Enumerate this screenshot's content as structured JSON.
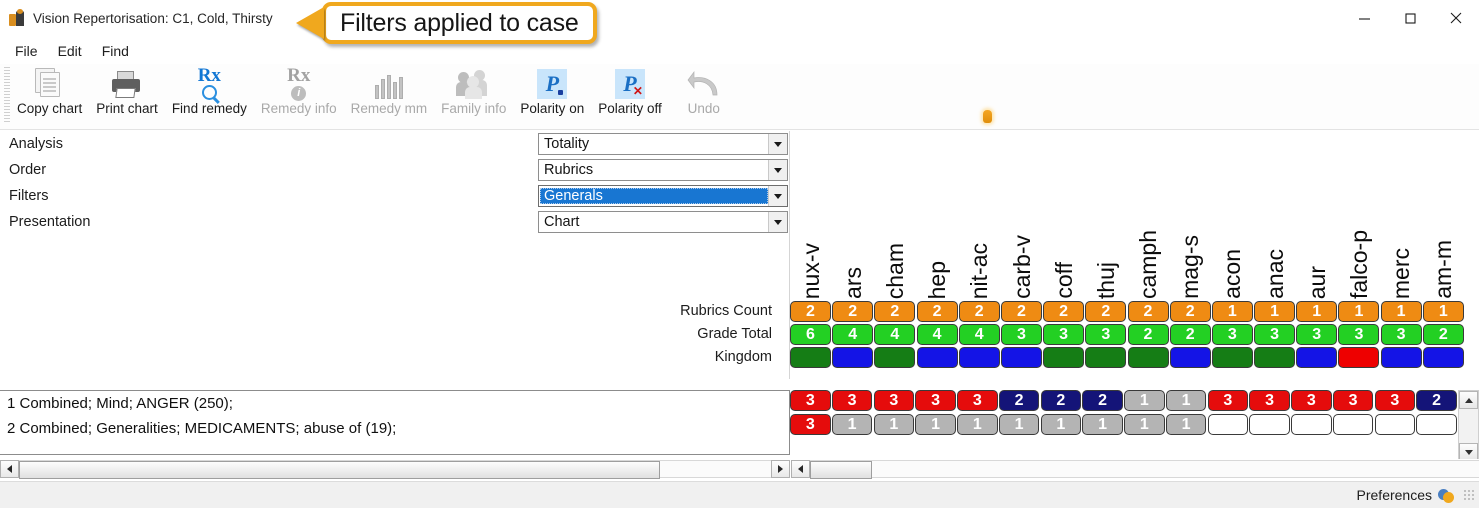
{
  "window": {
    "title": "Vision Repertorisation: C1, Cold, Thirsty",
    "app_icon": "vision-app-icon",
    "minimize": "–",
    "maximize": "□",
    "close": "✕"
  },
  "callout": {
    "text": "Filters applied to case",
    "accent_color": "#f0a81e"
  },
  "menubar": {
    "items": [
      {
        "label": "File"
      },
      {
        "label": "Edit"
      },
      {
        "label": "Find"
      }
    ]
  },
  "toolbar": {
    "buttons": [
      {
        "label": "Copy chart",
        "icon": "copy-chart-icon",
        "enabled": true
      },
      {
        "label": "Print chart",
        "icon": "print-chart-icon",
        "enabled": true
      },
      {
        "label": "Find remedy",
        "icon": "find-remedy-icon",
        "enabled": true
      },
      {
        "label": "Remedy info",
        "icon": "remedy-info-icon",
        "enabled": false
      },
      {
        "label": "Remedy mm",
        "icon": "remedy-mm-icon",
        "enabled": false
      },
      {
        "label": "Family info",
        "icon": "family-info-icon",
        "enabled": false
      },
      {
        "label": "Polarity on",
        "icon": "polarity-on-icon",
        "enabled": true
      },
      {
        "label": "Polarity off",
        "icon": "polarity-off-icon",
        "enabled": true
      },
      {
        "label": "Undo",
        "icon": "undo-icon",
        "enabled": false
      }
    ]
  },
  "settings": {
    "rows": [
      {
        "label": "Analysis",
        "value": "Totality",
        "selected": false
      },
      {
        "label": "Order",
        "value": "Rubrics",
        "selected": false
      },
      {
        "label": "Filters",
        "value": "Generals",
        "selected": true
      },
      {
        "label": "Presentation",
        "value": "Chart",
        "selected": false
      }
    ]
  },
  "summary_labels": {
    "rubrics_count": "Rubrics Count",
    "grade_total": "Grade Total",
    "kingdom": "Kingdom"
  },
  "rubrics": [
    {
      "text": "1 Combined; Mind; ANGER (250);"
    },
    {
      "text": "2 Combined; Generalities; MEDICAMENTS; abuse of (19);"
    }
  ],
  "statusbar": {
    "preferences": "Preferences",
    "preferences_icon": "preferences-icon"
  },
  "chart_data": {
    "type": "table",
    "title": "Vision Repertorisation Chart",
    "categories": [
      "nux-v",
      "ars",
      "cham",
      "hep",
      "nit-ac",
      "carb-v",
      "coff",
      "thuj",
      "camph",
      "mag-s",
      "acon",
      "anac",
      "aur",
      "falco-p",
      "merc",
      "am-m"
    ],
    "series": [
      {
        "name": "Rubrics Count",
        "color": "#ef8b13",
        "values": [
          2,
          2,
          2,
          2,
          2,
          2,
          2,
          2,
          2,
          2,
          1,
          1,
          1,
          1,
          1,
          1
        ]
      },
      {
        "name": "Grade Total",
        "color": "#23d023",
        "values": [
          6,
          4,
          4,
          4,
          4,
          3,
          3,
          3,
          2,
          2,
          3,
          3,
          3,
          3,
          3,
          2
        ]
      },
      {
        "name": "Kingdom",
        "values": [
          "",
          "",
          "",
          "",
          "",
          "",
          "",
          "",
          "",
          "",
          "",
          "",
          "",
          "",
          "",
          ""
        ],
        "colors": [
          "kgreen",
          "kblue",
          "kgreen",
          "kblue",
          "kblue",
          "kblue",
          "kgreen",
          "kgreen",
          "kgreen",
          "kblue",
          "kgreen",
          "kgreen",
          "kblue",
          "kred",
          "kblue",
          "kblue"
        ]
      },
      {
        "name": "1 Combined; Mind; ANGER (250);",
        "values": [
          3,
          3,
          3,
          3,
          3,
          2,
          2,
          2,
          1,
          1,
          3,
          3,
          3,
          3,
          3,
          2
        ],
        "colors": [
          "red",
          "red",
          "red",
          "red",
          "red",
          "navy",
          "navy",
          "navy",
          "gray",
          "gray",
          "red",
          "red",
          "red",
          "red",
          "red",
          "navy"
        ]
      },
      {
        "name": "2 Combined; Generalities; MEDICAMENTS; abuse of (19);",
        "values": [
          3,
          1,
          1,
          1,
          1,
          1,
          1,
          1,
          1,
          1,
          "",
          "",
          "",
          "",
          "",
          ""
        ],
        "colors": [
          "red",
          "gray",
          "gray",
          "gray",
          "gray",
          "gray",
          "gray",
          "gray",
          "gray",
          "gray",
          "empty",
          "empty",
          "empty",
          "empty",
          "empty",
          "empty"
        ]
      }
    ],
    "legend_position": "none",
    "grid": false
  }
}
